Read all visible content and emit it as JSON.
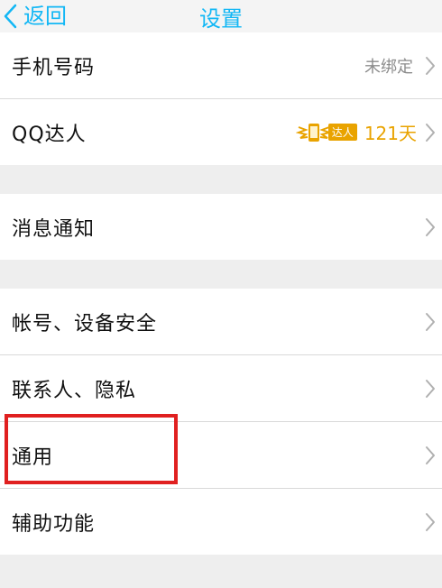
{
  "navbar": {
    "back_label": "返回",
    "title": "设置",
    "accent_color": "#12b7f5"
  },
  "groups": [
    {
      "items": [
        {
          "label": "手机号码",
          "value": "未绑定"
        },
        {
          "label": "QQ达人",
          "badge": "达人",
          "days": "121天"
        }
      ]
    },
    {
      "items": [
        {
          "label": "消息通知"
        }
      ]
    },
    {
      "items": [
        {
          "label": "帐号、设备安全"
        },
        {
          "label": "联系人、隐私"
        },
        {
          "label": "通用"
        },
        {
          "label": "辅助功能"
        }
      ]
    }
  ],
  "highlight": {
    "target": "通用",
    "color": "#e02020"
  },
  "icons": {
    "back": "chevron-left-icon",
    "disclosure": "chevron-right-icon",
    "vip": "phone-wings-icon"
  }
}
